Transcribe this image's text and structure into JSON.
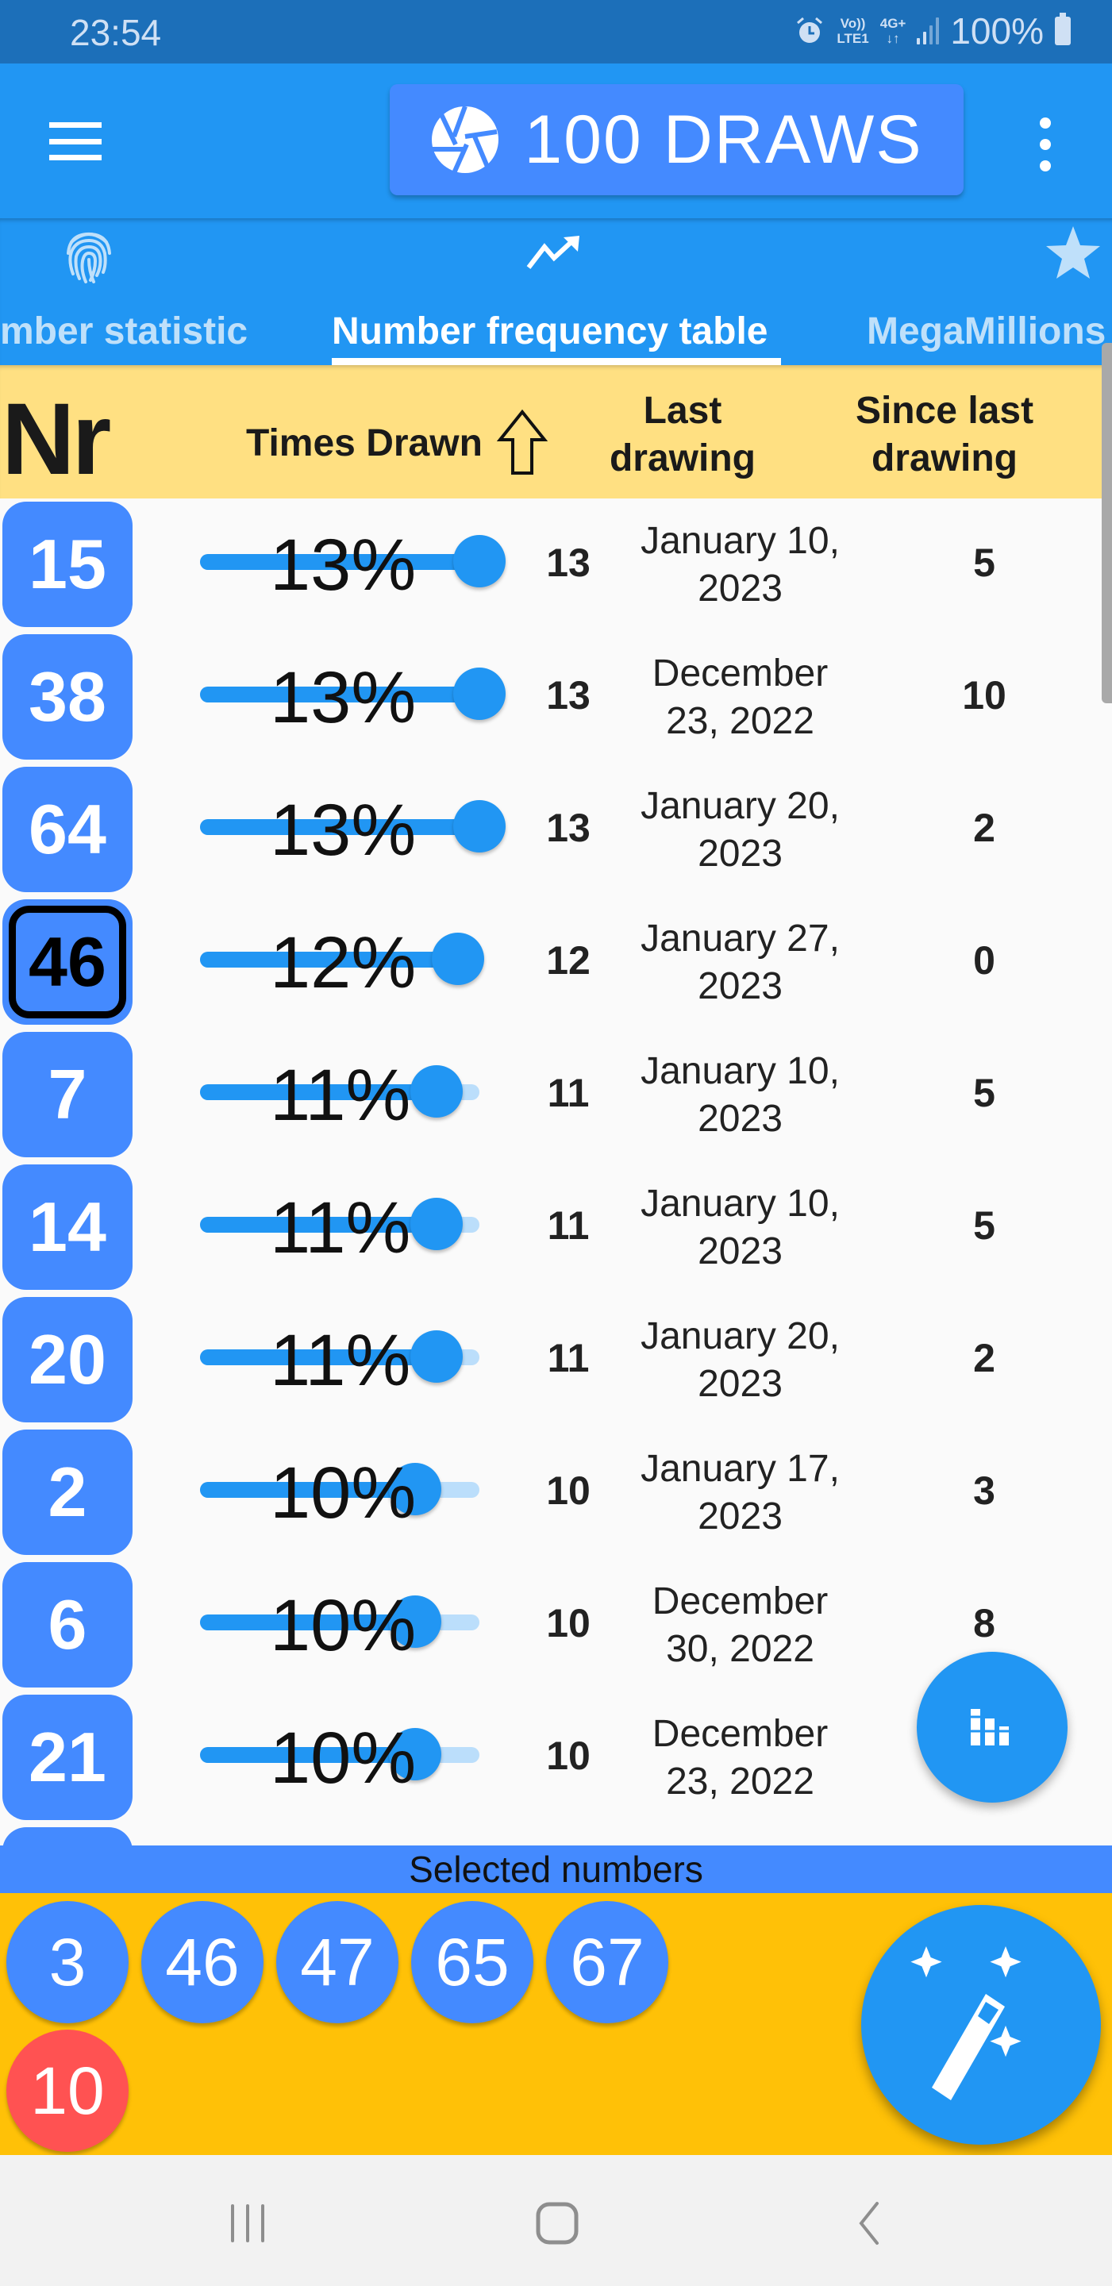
{
  "status_bar": {
    "time": "23:54",
    "volte": "Vo))",
    "lte": "LTE1",
    "network": "4G+",
    "battery": "100%"
  },
  "app_bar": {
    "draws_button_label": "100 DRAWS",
    "icons": {
      "menu": "hamburger-menu-icon",
      "draws": "aperture-icon",
      "more": "more-vert-icon"
    }
  },
  "tabs": [
    {
      "label": "Number statistic",
      "visible_label": "mber statistic",
      "icon": "fingerprint-icon",
      "active": false
    },
    {
      "label": "Number frequency table",
      "visible_label": "Number frequency table",
      "icon": "trending-up-icon",
      "active": true
    },
    {
      "label": "MegaMillions",
      "visible_label": "MegaMillions",
      "icon": "star-icon",
      "active": false
    }
  ],
  "table": {
    "headers": {
      "nr": "Nr",
      "times_drawn": "Times Drawn",
      "last_drawing_1": "Last",
      "last_drawing_2": "drawing",
      "since_last_1": "Since last",
      "since_last_2": "drawing"
    },
    "sort": "ascending-arrow",
    "slider_max": 13,
    "rows": [
      {
        "nr": "15",
        "percent": "13%",
        "times": 13,
        "times_label": "13",
        "last_1": "January 10,",
        "last_2": "2023",
        "since": "5",
        "highlighted": false
      },
      {
        "nr": "38",
        "percent": "13%",
        "times": 13,
        "times_label": "13",
        "last_1": "December",
        "last_2": "23, 2022",
        "since": "10",
        "highlighted": false
      },
      {
        "nr": "64",
        "percent": "13%",
        "times": 13,
        "times_label": "13",
        "last_1": "January 20,",
        "last_2": "2023",
        "since": "2",
        "highlighted": false
      },
      {
        "nr": "46",
        "percent": "12%",
        "times": 12,
        "times_label": "12",
        "last_1": "January 27,",
        "last_2": "2023",
        "since": "0",
        "highlighted": true
      },
      {
        "nr": "7",
        "percent": "11%",
        "times": 11,
        "times_label": "11",
        "last_1": "January 10,",
        "last_2": "2023",
        "since": "5",
        "highlighted": false
      },
      {
        "nr": "14",
        "percent": "11%",
        "times": 11,
        "times_label": "11",
        "last_1": "January 10,",
        "last_2": "2023",
        "since": "5",
        "highlighted": false
      },
      {
        "nr": "20",
        "percent": "11%",
        "times": 11,
        "times_label": "11",
        "last_1": "January 20,",
        "last_2": "2023",
        "since": "2",
        "highlighted": false
      },
      {
        "nr": "2",
        "percent": "10%",
        "times": 10,
        "times_label": "10",
        "last_1": "January 17,",
        "last_2": "2023",
        "since": "3",
        "highlighted": false
      },
      {
        "nr": "6",
        "percent": "10%",
        "times": 10,
        "times_label": "10",
        "last_1": "December",
        "last_2": "30, 2022",
        "since": "8",
        "highlighted": false
      },
      {
        "nr": "21",
        "percent": "10%",
        "times": 10,
        "times_label": "10",
        "last_1": "December",
        "last_2": "23, 2022",
        "since": "",
        "highlighted": false
      }
    ]
  },
  "fab_stats": {
    "icon": "bar-chart-icon"
  },
  "selected": {
    "title": "Selected numbers",
    "main_numbers": [
      "3",
      "46",
      "47",
      "65",
      "67"
    ],
    "bonus_numbers": [
      "10"
    ],
    "colors": {
      "main": "#448AFF",
      "bonus": "#FF5252",
      "panel": "#FFC107"
    }
  },
  "fab_wand": {
    "icon": "magic-wand-icon"
  },
  "nav": {
    "recents": "recents-icon",
    "home": "home-icon",
    "back": "back-icon"
  },
  "colors": {
    "primary": "#2196F3",
    "accent": "#448AFF",
    "header": "#FFE082"
  }
}
